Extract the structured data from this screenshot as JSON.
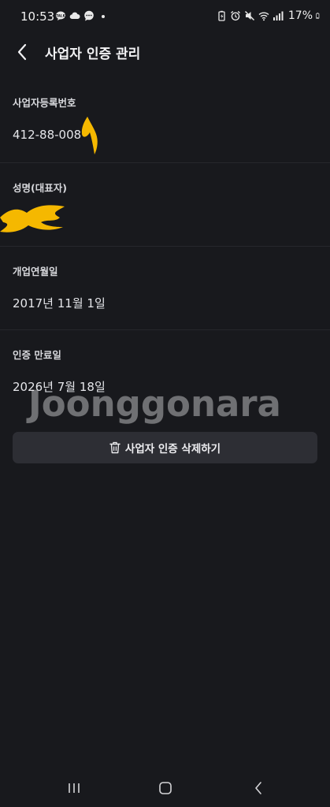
{
  "status_bar": {
    "time": "10:53",
    "battery": "17%",
    "left_icons": [
      "talk-icon",
      "cloud-icon",
      "chat-icon",
      "dot-icon"
    ],
    "right_icons": [
      "battery-saver-icon",
      "alarm-icon",
      "mute-icon",
      "wifi-icon",
      "signal-icon"
    ]
  },
  "header": {
    "title": "사업자 인증 관리",
    "back_icon": "chevron-left-icon"
  },
  "sections": {
    "business_number": {
      "label": "사업자등록번호",
      "value": "412-88-008"
    },
    "representative": {
      "label": "성명(대표자)",
      "value": ""
    },
    "opening_date": {
      "label": "개업연월일",
      "value": "2017년 11월 1일"
    },
    "expiry_date": {
      "label": "인증 만료일",
      "value": "2026년 7월 18일"
    }
  },
  "watermark": "Joonggonara",
  "delete_button": {
    "label": "사업자 인증 삭제하기",
    "icon": "trash-icon"
  },
  "nav_bar": {
    "icons": [
      "recent-apps-icon",
      "home-icon",
      "back-icon"
    ]
  },
  "colors": {
    "background": "#18191d",
    "button_bg": "#2d2e34",
    "redaction": "#f5b800"
  }
}
